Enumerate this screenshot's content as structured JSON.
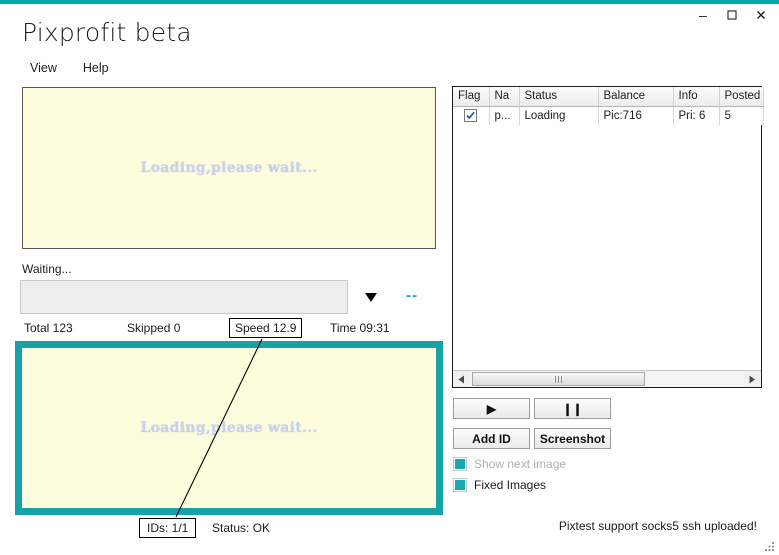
{
  "window": {
    "title": "Pixprofit beta",
    "controls": {
      "minimize": "minimize-icon",
      "maximize": "maximize-icon",
      "close": "close-icon"
    },
    "accent_color": "#00a9ac"
  },
  "menubar": {
    "items": [
      {
        "label": "View"
      },
      {
        "label": "Help"
      }
    ]
  },
  "preview": {
    "top_panel": {
      "text": "Loading,please wait...",
      "background": "#fdfdde"
    },
    "bottom_panel": {
      "text": "Loading,please wait...",
      "background": "#fdfdde",
      "border_color": "#17a2a8"
    }
  },
  "progress": {
    "label": "Waiting...",
    "percent": 0,
    "caret_icon": "chevron-down-icon",
    "indicator": "--"
  },
  "stats": {
    "total": "Total 123",
    "skipped": "Skipped 0",
    "speed": "Speed 12.9",
    "time": "Time 09:31"
  },
  "bottom_status": {
    "ids": "IDs: 1/1",
    "status": "Status: OK"
  },
  "grid": {
    "columns": [
      "Flag",
      "Na",
      "Status",
      "Balance",
      "Info",
      "Posted"
    ],
    "rows": [
      {
        "flag_checked": true,
        "name": "p...",
        "status": "Loading",
        "balance": "Pic:716",
        "info": "Pri: 6",
        "posted": "5"
      }
    ],
    "scrollbar": {
      "left_arrow": "triangle-left-icon",
      "right_arrow": "triangle-right-icon"
    }
  },
  "actions": {
    "play": "▶",
    "pause": "❙❙",
    "add_id": "Add ID",
    "screenshot": "Screenshot"
  },
  "options": [
    {
      "label": "Show next image",
      "checked": true,
      "disabled": true
    },
    {
      "label": "Fixed Images",
      "checked": true,
      "disabled": false
    }
  ],
  "footer": {
    "note": "Pixtest support socks5  ssh uploaded!"
  }
}
